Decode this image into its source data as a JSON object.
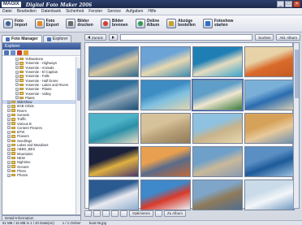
{
  "window": {
    "logo": "MAGIX",
    "title": "Digital Foto Maker 2006"
  },
  "menu": [
    "Datei",
    "Bearbeiten",
    "Datenbank",
    "Sicherheit",
    "Fenster",
    "Service",
    "Aufgaben",
    "Hilfe"
  ],
  "toolbar": [
    {
      "label": "Foto\nImport",
      "icon": "camera-icon",
      "cls": "cam"
    },
    {
      "label": "Foto\nExport",
      "icon": "export-icon",
      "cls": "exp"
    },
    {
      "label": "Bilder\ndrucken",
      "icon": "printer-icon",
      "cls": "print"
    },
    {
      "label": "Bilder\nbrennen",
      "icon": "disc-icon",
      "cls": "burn"
    },
    {
      "label": "Online\nAlbum",
      "icon": "globe-icon",
      "cls": "web"
    },
    {
      "label": "Abzüge\nbestellen",
      "icon": "order-icon",
      "cls": "order"
    },
    {
      "label": "Fotoshow\nstarten",
      "icon": "slideshow-icon",
      "cls": "show"
    }
  ],
  "tabs": {
    "manager": "Foto Manager",
    "explorer": "Explorer"
  },
  "left_panel": {
    "header": "Explorer",
    "tree": [
      "Yellowstone",
      "Yosemite - Highways",
      "Yosemite - Animals",
      "Yosemite - El Capitan",
      "Yosemite - Falls",
      "Yosemite - Half Dome",
      "Yosemite - Lakes and Rivers",
      "Yosemite - Plants",
      "Yosemite - Valley",
      "Plants",
      "slideshow",
      "8GB Orbits",
      "Rivers",
      "Sunsets",
      "Traffic",
      "Various B",
      "Content Pictures",
      "BTW",
      "Flowers",
      "Seedlings",
      "Lakes and Meadows",
      "ABED_BES",
      "Mountains",
      "NEW",
      "Nightime",
      "Oceans",
      "Photo",
      "Photos"
    ],
    "selected_index": 10
  },
  "detail_info": "Detail-Information",
  "nav": {
    "back": "Zurück",
    "search": "Suchen",
    "album": "Akt. Album"
  },
  "actions": {
    "optimize": "Optimieren",
    "album": "Zu Album"
  },
  "status": {
    "count": "61 MB / 15 MB in 1 / 20 Datei(en)",
    "folder": "1 / 1 Ordner",
    "selected": "boat 06.jpg"
  },
  "photos": [
    {
      "name": "photo-coast-cliffs",
      "colors": [
        "#4a7fb3",
        "#d9c7a0",
        "#2f6b8f"
      ]
    },
    {
      "name": "photo-hammock-beach",
      "colors": [
        "#6ba3d6",
        "#e8d9b0",
        "#3b8bb3"
      ]
    },
    {
      "name": "photo-bay-aerial",
      "colors": [
        "#1e7fb5",
        "#e6dcc0",
        "#3aa6c9"
      ]
    },
    {
      "name": "photo-starfish",
      "colors": [
        "#e8d3a8",
        "#d96a2a",
        "#c45a22"
      ]
    },
    {
      "name": "photo-sea-rocks",
      "colors": [
        "#2f6f9e",
        "#8fa7b8",
        "#1d4f77"
      ]
    },
    {
      "name": "photo-palm-beach",
      "colors": [
        "#3d8cc4",
        "#7fc0e0",
        "#e3d5ae"
      ]
    },
    {
      "name": "photo-jetty-palms",
      "colors": [
        "#5e9ec8",
        "#f0e6cf",
        "#3a7a3e"
      ]
    },
    {
      "name": "photo-deck-chair",
      "colors": [
        "#7ab0d8",
        "#2a6cb0",
        "#d9cfb3"
      ]
    },
    {
      "name": "photo-lagoon-boat",
      "colors": [
        "#4fb3c8",
        "#2a8fa8",
        "#e9e0c4"
      ]
    },
    {
      "name": "photo-shell-sand",
      "colors": [
        "#d6c29a",
        "#b9a27a",
        "#8f7b57"
      ]
    },
    {
      "name": "photo-beach-dunes",
      "colors": [
        "#8ec2e0",
        "#c9b38a",
        "#e8d8b0"
      ]
    },
    {
      "name": "photo-house-shore",
      "colors": [
        "#d6a25a",
        "#e8c99a",
        "#6b8fb0"
      ]
    },
    {
      "name": "photo-city-lights",
      "colors": [
        "#1a1f3a",
        "#e0b040",
        "#4a3a6a"
      ]
    },
    {
      "name": "photo-palm-sunset",
      "colors": [
        "#e8a050",
        "#5a6b8a",
        "#c06a3a"
      ]
    },
    {
      "name": "photo-coast-town",
      "colors": [
        "#6fa0c9",
        "#c9b99a",
        "#8a9ab0"
      ]
    },
    {
      "name": "photo-open-sea",
      "colors": [
        "#5a8fc4",
        "#1d5a9a",
        "#9fc2e0"
      ]
    },
    {
      "name": "photo-harbor-boats",
      "colors": [
        "#2a5a8f",
        "#e9e9ef",
        "#8fb0cf"
      ]
    },
    {
      "name": "photo-red-sail",
      "colors": [
        "#3f88c9",
        "#d93a2a",
        "#e8f0f7"
      ]
    },
    {
      "name": "photo-cliff-road",
      "colors": [
        "#7fa6c9",
        "#8f7a5a",
        "#4f6f8f"
      ]
    },
    {
      "name": "photo-white-boat",
      "colors": [
        "#c9dbe9",
        "#f3f6f9",
        "#6f9ac2"
      ]
    }
  ]
}
